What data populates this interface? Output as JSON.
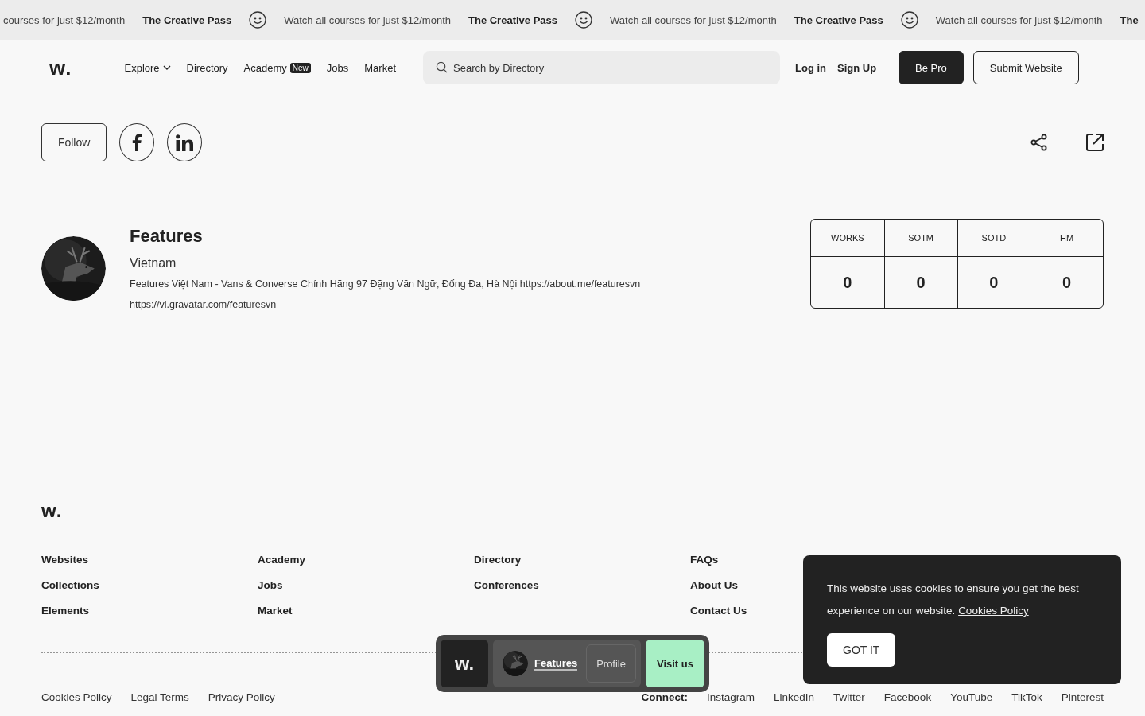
{
  "marquee": [
    {
      "kind": "text",
      "text": "courses for just $12/month"
    },
    {
      "kind": "title",
      "text": "The Creative Pass"
    },
    {
      "kind": "smiley"
    },
    {
      "kind": "text",
      "text": "Watch all courses for just $12/month"
    },
    {
      "kind": "title",
      "text": "The Creative Pass"
    },
    {
      "kind": "smiley"
    },
    {
      "kind": "text",
      "text": "Watch all courses for just $12/month"
    },
    {
      "kind": "title",
      "text": "The Creative Pass"
    },
    {
      "kind": "smiley"
    },
    {
      "kind": "text",
      "text": "Watch all courses for just $12/month"
    },
    {
      "kind": "title",
      "text": "The"
    }
  ],
  "header": {
    "logo": "w.",
    "nav": [
      {
        "label": "Explore",
        "dropdown": true
      },
      {
        "label": "Directory",
        "dropdown": false
      },
      {
        "label": "Academy",
        "badge": "New",
        "dropdown": false
      },
      {
        "label": "Jobs",
        "dropdown": false
      },
      {
        "label": "Market",
        "dropdown": false
      }
    ],
    "search": {
      "placeholder": "Search by Directory"
    },
    "links": [
      "Log in",
      "Sign Up"
    ],
    "pro_button": "Be Pro",
    "submit_button": "Submit Website"
  },
  "profile": {
    "follow": "Follow",
    "name": "Features",
    "country": "Vietnam",
    "bio": "Features Việt Nam - Vans & Converse Chính Hãng 97 Đặng Văn Ngữ, Đống Đa, Hà Nội https://about.me/featuresvn",
    "url": "https://vi.gravatar.com/featuresvn",
    "stats": [
      {
        "label": "WORKS",
        "value": "0"
      },
      {
        "label": "SOTM",
        "value": "0"
      },
      {
        "label": "SOTD",
        "value": "0"
      },
      {
        "label": "HM",
        "value": "0"
      }
    ]
  },
  "footer": {
    "logo": "w.",
    "columns": [
      [
        "Websites",
        "Collections",
        "Elements"
      ],
      [
        "Academy",
        "Jobs",
        "Market"
      ],
      [
        "Directory",
        "Conferences"
      ],
      [
        "FAQs",
        "About Us",
        "Contact Us"
      ]
    ],
    "legal": [
      "Cookies Policy",
      "Legal Terms",
      "Privacy Policy"
    ],
    "connect_label": "Connect:",
    "social": [
      "Instagram",
      "LinkedIn",
      "Twitter",
      "Facebook",
      "YouTube",
      "TikTok",
      "Pinterest"
    ]
  },
  "floating_bar": {
    "logo": "w.",
    "name": "Features",
    "profile": "Profile",
    "visit": "Visit us"
  },
  "cookie": {
    "text": "This website uses cookies to ensure you get the best experience on our website.",
    "link": "Cookies Policy",
    "button": "GOT IT"
  }
}
